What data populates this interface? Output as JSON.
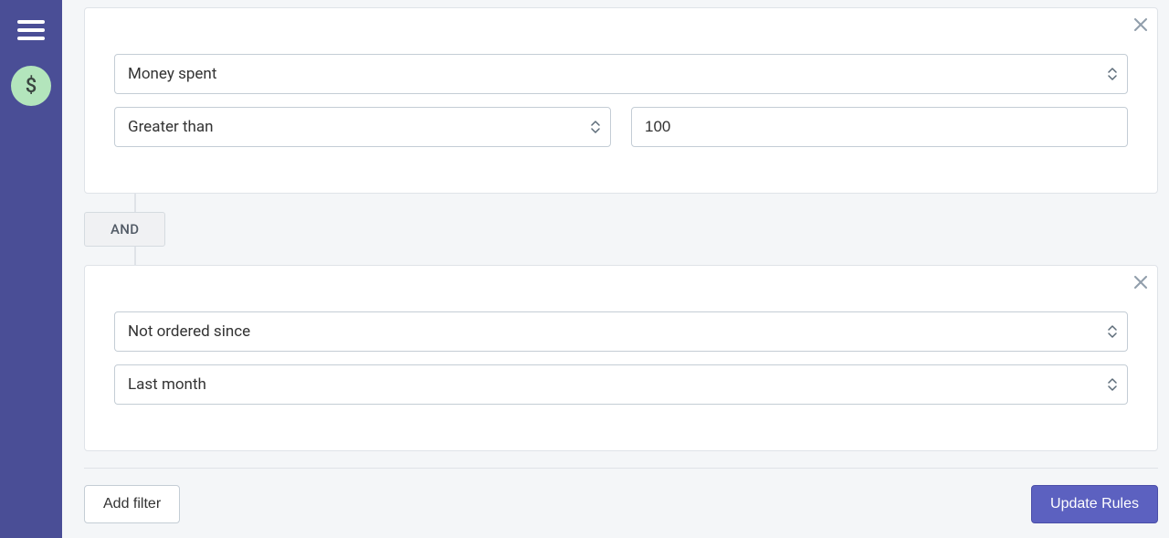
{
  "sidebar": {
    "avatar_glyph": "$"
  },
  "rules": [
    {
      "field": "Money spent",
      "operator": "Greater than",
      "value": "100"
    }
  ],
  "connector": "AND",
  "rules2": [
    {
      "field": "Not ordered since",
      "operator": "Last month"
    }
  ],
  "footer": {
    "add_filter": "Add filter",
    "update_rules": "Update Rules"
  }
}
